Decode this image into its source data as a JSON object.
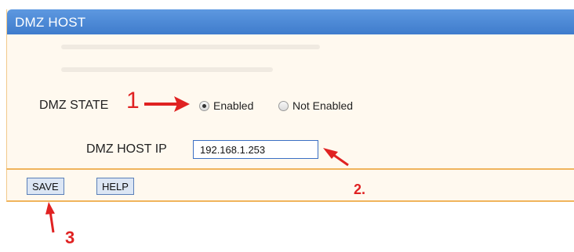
{
  "panel": {
    "title": "DMZ HOST"
  },
  "form": {
    "dmz_state_label": "DMZ STATE",
    "radio_enabled_label": "Enabled",
    "radio_not_enabled_label": "Not Enabled",
    "selected_state": "Enabled",
    "dmz_host_ip_label": "DMZ HOST IP",
    "dmz_host_ip_value": "192.168.1.253"
  },
  "buttons": {
    "save_label": "SAVE",
    "help_label": "HELP"
  },
  "annotations": {
    "step1": "1",
    "step2": "2.",
    "step3": "3",
    "color": "#e02222"
  },
  "colors": {
    "header": "#4a86d6",
    "panel_bg": "#fff9ef",
    "border_accent": "#f0b45c",
    "input_border": "#3a6fc4"
  }
}
